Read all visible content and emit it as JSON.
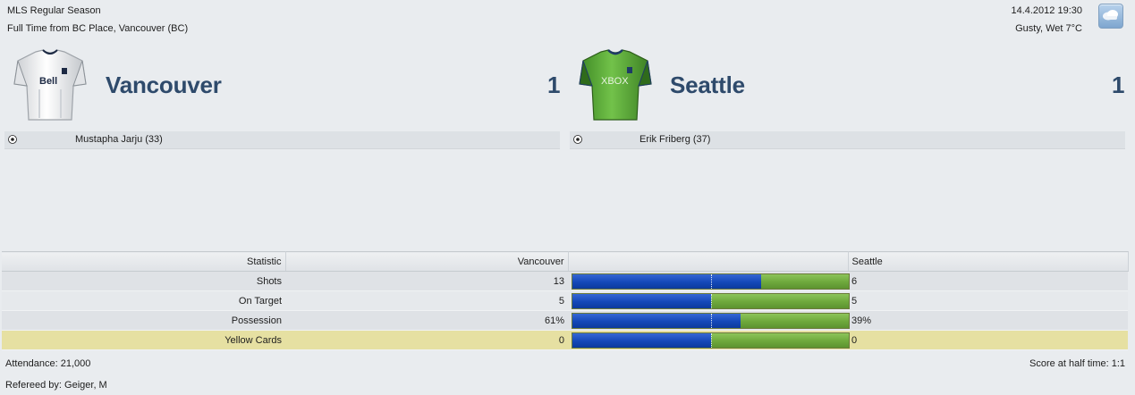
{
  "header": {
    "competition": "MLS Regular Season",
    "status": "Full Time from BC Place, Vancouver (BC)",
    "datetime": "14.4.2012 19:30",
    "weather": "Gusty, Wet 7°C",
    "weather_icon": "cloud-icon"
  },
  "home": {
    "name": "Vancouver",
    "score": "1",
    "shirt_sponsor": "Bell",
    "shirt_color": "#ffffff",
    "scorer": "Mustapha Jarju (33)"
  },
  "away": {
    "name": "Seattle",
    "score": "1",
    "shirt_sponsor": "XBOX",
    "shirt_color": "#5fae3a",
    "scorer": "Erik Friberg (37)"
  },
  "stats": {
    "col_statistic": "Statistic",
    "col_home": "Vancouver",
    "col_away": "Seattle",
    "rows": [
      {
        "label": "Shots",
        "home": "13",
        "away": "6",
        "home_share": 0.684
      },
      {
        "label": "On Target",
        "home": "5",
        "away": "5",
        "home_share": 0.5
      },
      {
        "label": "Possession",
        "home": "61%",
        "away": "39%",
        "home_share": 0.61
      },
      {
        "label": "Yellow Cards",
        "home": "0",
        "away": "0",
        "home_share": 0.5
      }
    ]
  },
  "colors": {
    "home_bar": "#1448b8",
    "away_bar": "#6ea83c",
    "highlight_row": "#e6e0a2"
  },
  "footer": {
    "attendance": "Attendance: 21,000",
    "referee": "Refereed by: Geiger, M",
    "half_time": "Score at half time: 1:1"
  }
}
